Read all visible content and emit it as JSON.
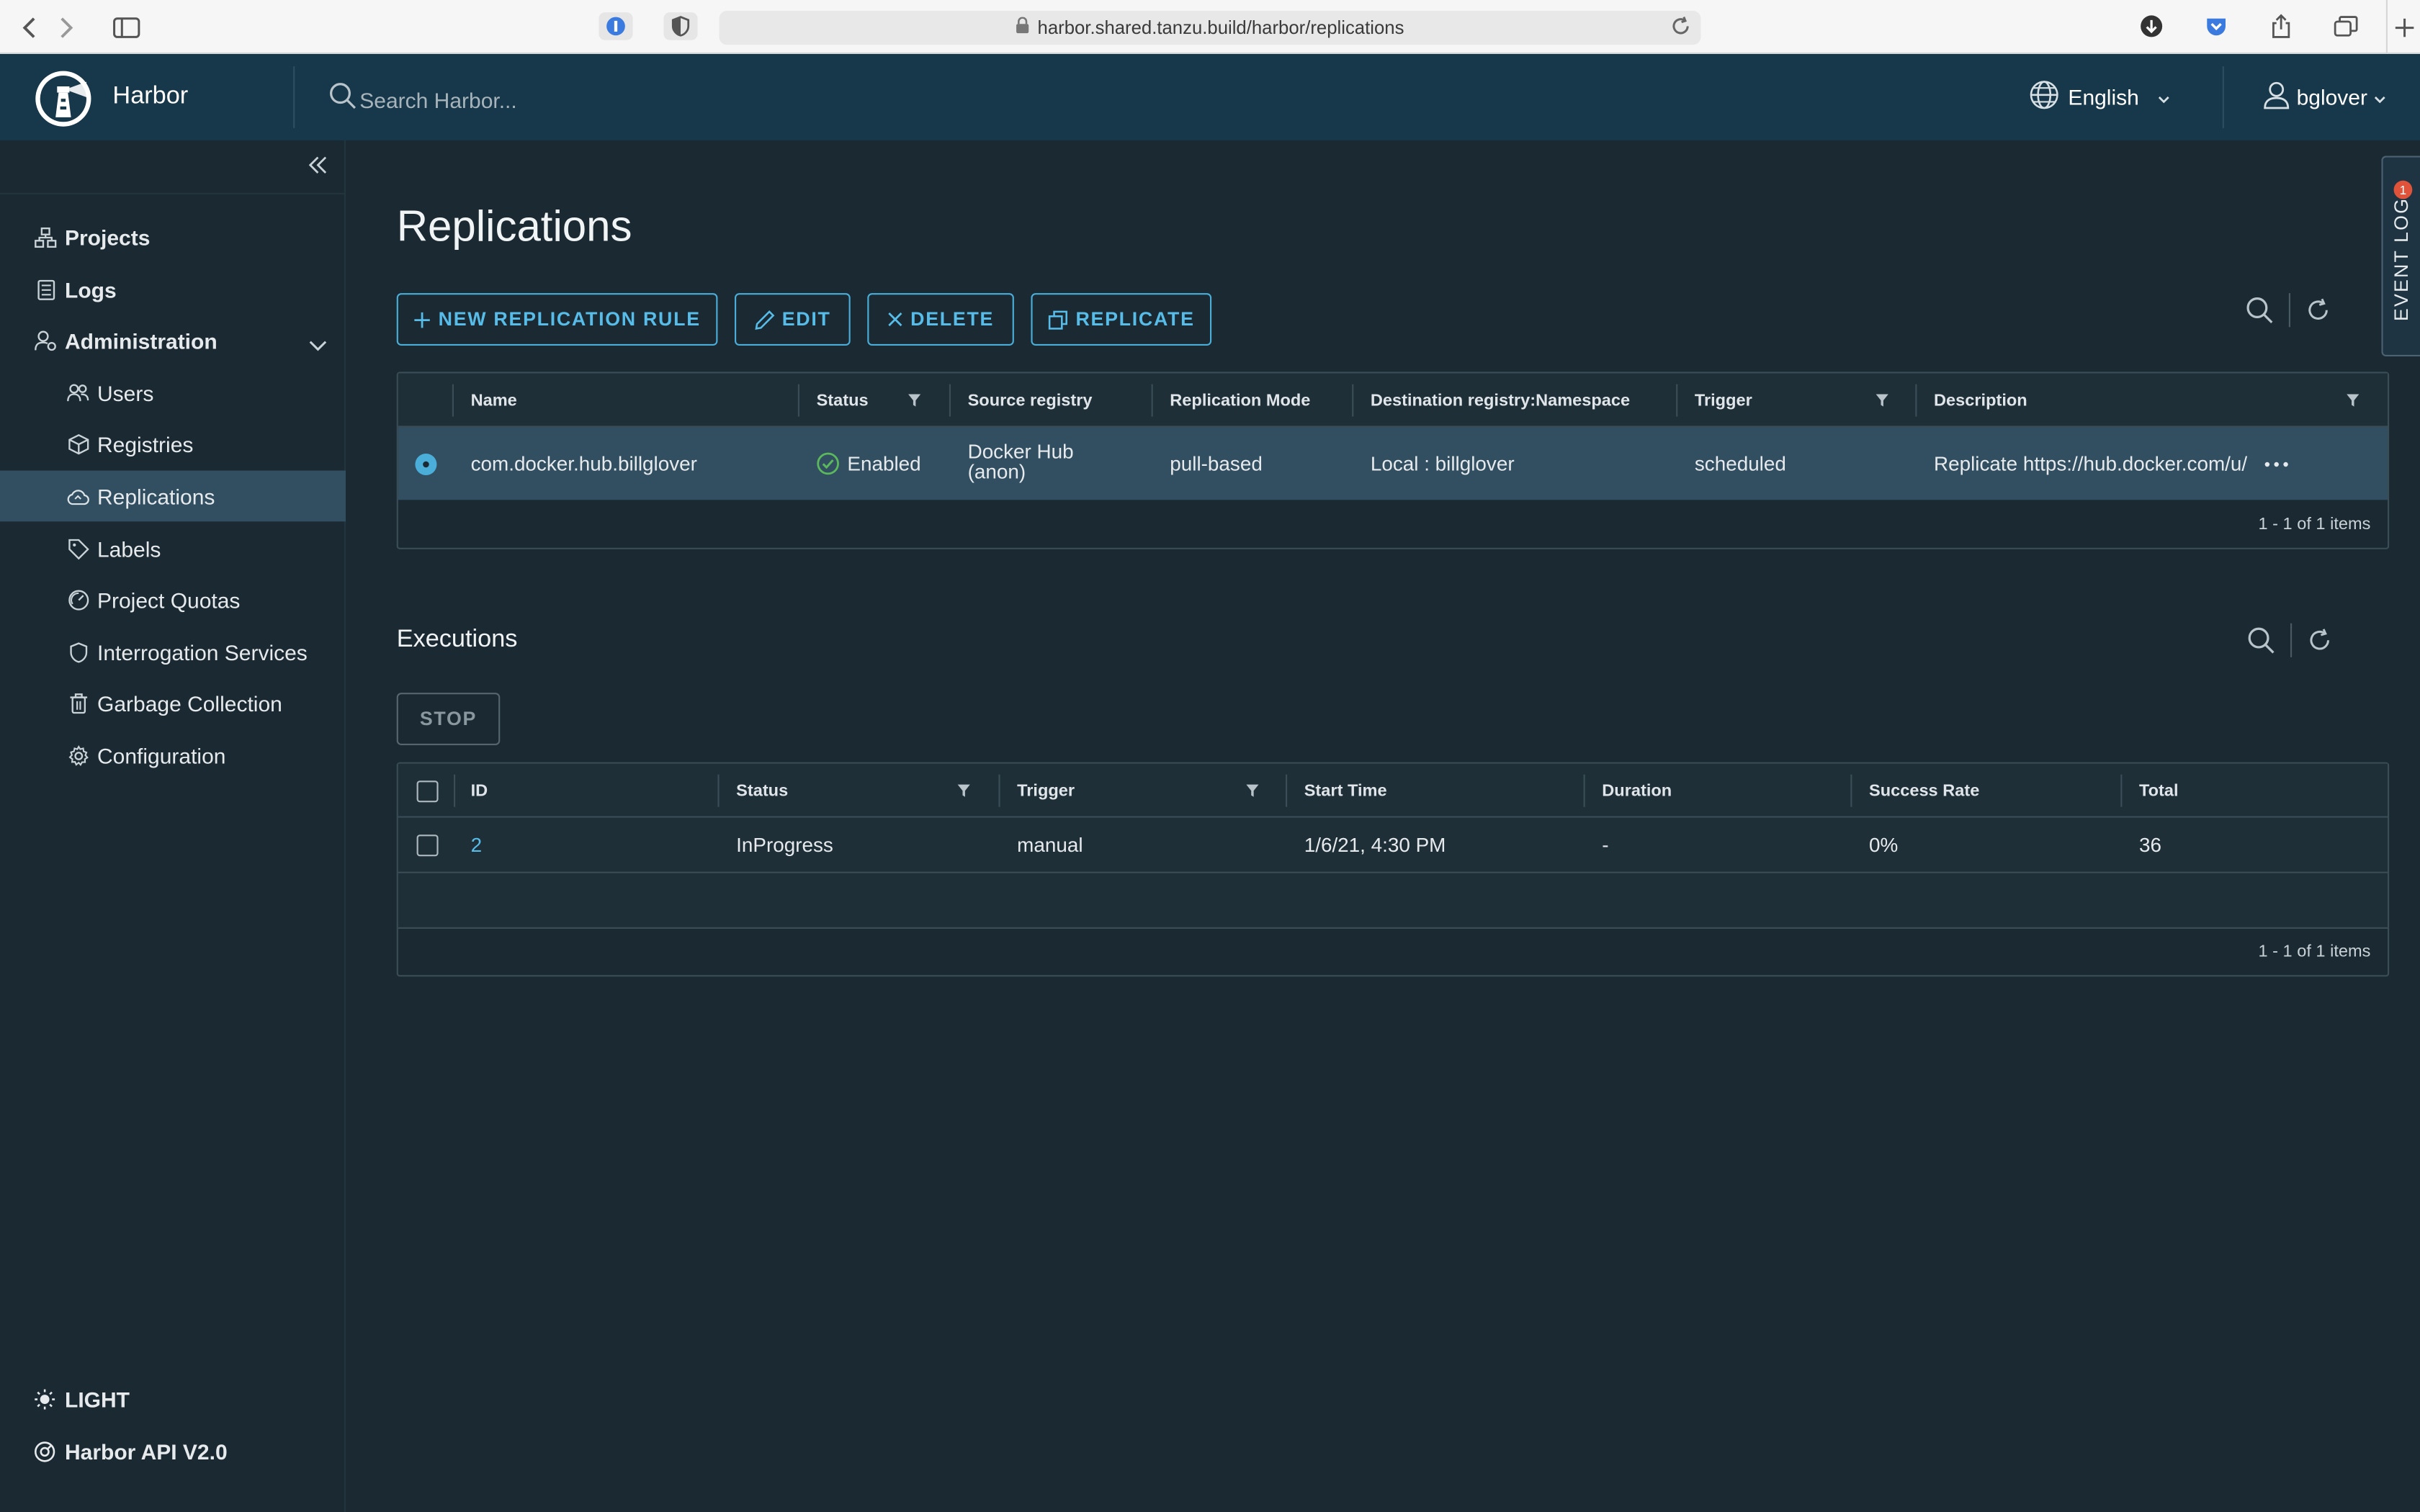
{
  "browser": {
    "url": "harbor.shared.tanzu.build/harbor/replications"
  },
  "header": {
    "brand": "Harbor",
    "search_placeholder": "Search Harbor...",
    "language": "English",
    "username": "bglover"
  },
  "sidebar": {
    "items": [
      {
        "label": "Projects",
        "icon": "projects-icon"
      },
      {
        "label": "Logs",
        "icon": "logs-icon"
      },
      {
        "label": "Administration",
        "icon": "administration-icon"
      },
      {
        "label": "Users",
        "icon": "users-icon"
      },
      {
        "label": "Registries",
        "icon": "registries-icon"
      },
      {
        "label": "Replications",
        "icon": "replications-icon",
        "active": true
      },
      {
        "label": "Labels",
        "icon": "labels-icon"
      },
      {
        "label": "Project Quotas",
        "icon": "quotas-icon"
      },
      {
        "label": "Interrogation Services",
        "icon": "shield-icon"
      },
      {
        "label": "Garbage Collection",
        "icon": "trash-icon"
      },
      {
        "label": "Configuration",
        "icon": "gear-icon"
      }
    ],
    "theme_toggle": "LIGHT",
    "api_link": "Harbor API V2.0"
  },
  "page": {
    "title": "Replications",
    "actions": {
      "new_rule": "NEW REPLICATION RULE",
      "edit": "EDIT",
      "delete": "DELETE",
      "replicate": "REPLICATE"
    }
  },
  "rules_table": {
    "columns": [
      "Name",
      "Status",
      "Source registry",
      "Replication Mode",
      "Destination registry:Namespace",
      "Trigger",
      "Description"
    ],
    "rows": [
      {
        "name": "com.docker.hub.billglover",
        "status": "Enabled",
        "source_registry_line1": "Docker Hub",
        "source_registry_line2": "(anon)",
        "mode": "pull-based",
        "destination": "Local : billglover",
        "trigger": "scheduled",
        "description": "Replicate https://hub.docker.com/u/"
      }
    ],
    "footer": "1 - 1 of 1 items"
  },
  "executions": {
    "title": "Executions",
    "stop_label": "STOP",
    "columns": [
      "ID",
      "Status",
      "Trigger",
      "Start Time",
      "Duration",
      "Success Rate",
      "Total"
    ],
    "rows": [
      {
        "id": "2",
        "status": "InProgress",
        "trigger": "manual",
        "start_time": "1/6/21, 4:30 PM",
        "duration": "-",
        "success_rate": "0%",
        "total": "36"
      }
    ],
    "footer": "1 - 1 of 1 items"
  },
  "event_log": {
    "label": "EVENT LOG",
    "badge": "1"
  },
  "colors": {
    "header_bg": "#17374a",
    "body_bg": "#1b2a32",
    "accent": "#4aaed9",
    "active_nav": "#324f62",
    "success": "#5cb85c",
    "badge": "#e0533b"
  }
}
